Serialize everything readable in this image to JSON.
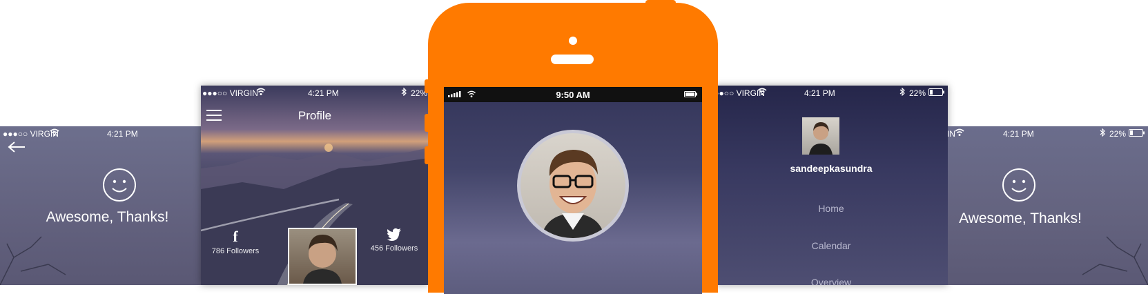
{
  "screen_left": {
    "status": {
      "carrier": "●●●○○ VIRGIN",
      "time": "4:21 PM"
    },
    "message": "Awesome, Thanks!"
  },
  "screen_profile": {
    "status": {
      "carrier": "●●●○○ VIRGIN",
      "time": "4:21 PM",
      "battery": "22%"
    },
    "title": "Profile",
    "facebook": {
      "icon": "facebook-icon",
      "followers": "786 Followers"
    },
    "twitter": {
      "icon": "twitter-icon",
      "followers": "456 Followers"
    }
  },
  "phone": {
    "status": {
      "time": "9:50 AM"
    }
  },
  "screen_menu": {
    "status": {
      "carrier": "●●●○○ VIRGIN",
      "time": "4:21 PM",
      "battery": "22%"
    },
    "username": "sandeepkasundra",
    "menu": [
      "Home",
      "Calendar",
      "Overview"
    ]
  },
  "screen_right": {
    "status": {
      "carrier": "●●●○○ VIRGIN",
      "time": "4:21 PM",
      "battery": "22%"
    },
    "message": "Awesome, Thanks!"
  },
  "colors": {
    "phone_frame": "#ff7a00",
    "screen_bg": "#3a3b5f"
  }
}
